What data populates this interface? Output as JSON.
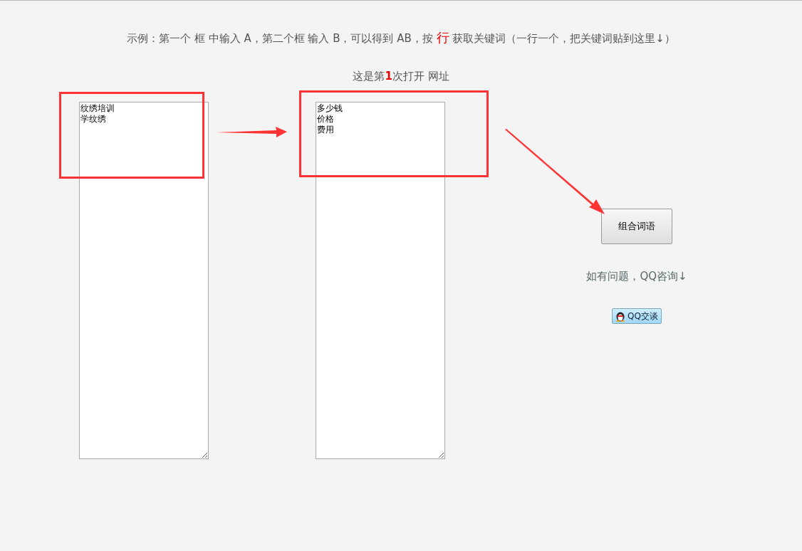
{
  "instruction": {
    "before": "示例：第一个 框 中输入 A，第二个框 输入 B，可以得到 AB，按 ",
    "highlight": "行",
    "after": " 获取关键词（一行一个，把关键词贴到这里↓）"
  },
  "counter": {
    "before": "这是第",
    "count": "1",
    "after": "次打开",
    "link": "网址"
  },
  "fields": [
    {
      "lines": [
        "纹绣培训",
        "学纹绣"
      ]
    },
    {
      "lines": [
        "多少钱",
        "价格",
        "费用"
      ]
    }
  ],
  "combine_button": "组合词语",
  "help_text": "如有问题，QQ咨询↓",
  "qq_button": "QQ交谈"
}
